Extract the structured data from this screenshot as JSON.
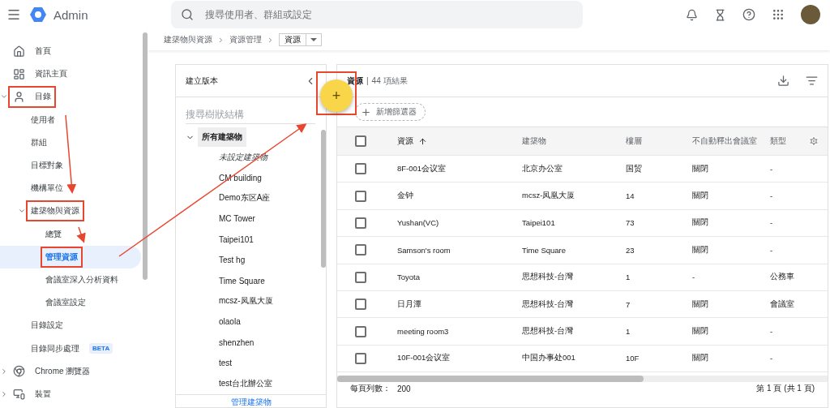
{
  "header": {
    "product": "Admin",
    "search": {
      "placeholder": "搜尋使用者、群組或設定"
    }
  },
  "sidebar": {
    "items": [
      {
        "label": "首頁",
        "selected": false,
        "annotated": false
      },
      {
        "label": "資訊主頁",
        "selected": false,
        "annotated": false
      },
      {
        "label": "目錄",
        "selected": false,
        "annotated": true,
        "expanded": true,
        "children": [
          {
            "label": "使用者",
            "selected": false,
            "annotated": false
          },
          {
            "label": "群組",
            "selected": false,
            "annotated": false
          },
          {
            "label": "目標對象",
            "selected": false,
            "annotated": false
          },
          {
            "label": "機構單位",
            "selected": false,
            "annotated": false
          },
          {
            "label": "建築物與資源",
            "selected": false,
            "annotated": true,
            "expanded": true,
            "children": [
              {
                "label": "總覽",
                "selected": false,
                "annotated": false
              },
              {
                "label": "管理資源",
                "selected": true,
                "annotated": true
              },
              {
                "label": "會議室深入分析資料",
                "selected": false,
                "annotated": false
              },
              {
                "label": "會議室設定",
                "selected": false,
                "annotated": false
              }
            ]
          },
          {
            "label": "目錄設定",
            "selected": false,
            "annotated": false
          },
          {
            "label": "目錄同步處理",
            "badge": "BETA",
            "selected": false,
            "annotated": false
          }
        ]
      },
      {
        "label": "Chrome 瀏覽器",
        "selected": false,
        "annotated": false,
        "expanded": false
      },
      {
        "label": "裝置",
        "selected": false,
        "annotated": false,
        "expanded": false
      }
    ]
  },
  "breadcrumb": {
    "items": [
      "建築物與資源",
      "資源管理"
    ],
    "current": "資源"
  },
  "tree_panel": {
    "title": "建立版本",
    "search": {
      "placeholder": "搜尋樹狀結構"
    },
    "root": {
      "label": "所有建築物",
      "selected": true,
      "expanded": true,
      "children": [
        {
          "label": "未設定建築物",
          "kind": "unassigned"
        },
        {
          "label": "CM building",
          "kind": "building"
        },
        {
          "label": "Demo东区A座",
          "kind": "building"
        },
        {
          "label": "MC Tower",
          "kind": "building"
        },
        {
          "label": "Taipei101",
          "kind": "building"
        },
        {
          "label": "Test hg",
          "kind": "building"
        },
        {
          "label": "Time Square",
          "kind": "building"
        },
        {
          "label": "mcsz-凤凰大厦",
          "kind": "building"
        },
        {
          "label": "olaola",
          "kind": "building"
        },
        {
          "label": "shenzhen",
          "kind": "building"
        },
        {
          "label": "test",
          "kind": "building"
        },
        {
          "label": "test台北辦公室",
          "kind": "building"
        }
      ]
    },
    "footer_link": "管理建築物"
  },
  "fab": {
    "label": "+",
    "annotated": true
  },
  "resources": {
    "title": "資源",
    "separator": "|",
    "count": "44 項結果",
    "add_filter": "新增篩選器",
    "select_all": {
      "checked": false
    },
    "columns": [
      {
        "label": "資源",
        "sorted": true
      },
      {
        "label": "建築物",
        "sorted": false
      },
      {
        "label": "樓層",
        "sorted": false
      },
      {
        "label": "不自動釋出會議室",
        "sorted": false
      },
      {
        "label": "類型",
        "sorted": false
      }
    ],
    "rows": [
      {
        "checked": false,
        "cells": [
          "8F-001会议室",
          "北京办公室",
          "国贸",
          "關閉",
          "-"
        ]
      },
      {
        "checked": false,
        "cells": [
          "金钟",
          "mcsz-凤凰大厦",
          "14",
          "關閉",
          "-"
        ]
      },
      {
        "checked": false,
        "cells": [
          "Yushan(VC)",
          "Taipei101",
          "73",
          "關閉",
          "-"
        ]
      },
      {
        "checked": false,
        "cells": [
          "Samson's room",
          "Time Square",
          "23",
          "關閉",
          "-"
        ]
      },
      {
        "checked": false,
        "cells": [
          "Toyota",
          "思想科技-台灣",
          "1",
          "-",
          "公務車"
        ]
      },
      {
        "checked": false,
        "cells": [
          "日月潭",
          "思想科技-台灣",
          "7",
          "關閉",
          "會議室"
        ]
      },
      {
        "checked": false,
        "cells": [
          "meeting room3",
          "思想科技-台灣",
          "1",
          "關閉",
          "-"
        ]
      },
      {
        "checked": false,
        "cells": [
          "10F-001会议室",
          "中国办事处001",
          "10F",
          "關閉",
          "-"
        ]
      }
    ],
    "pagination": {
      "rows_label": "每頁列數：",
      "rows_value": "200",
      "page": "第 1 頁 (共 1 頁)"
    }
  }
}
